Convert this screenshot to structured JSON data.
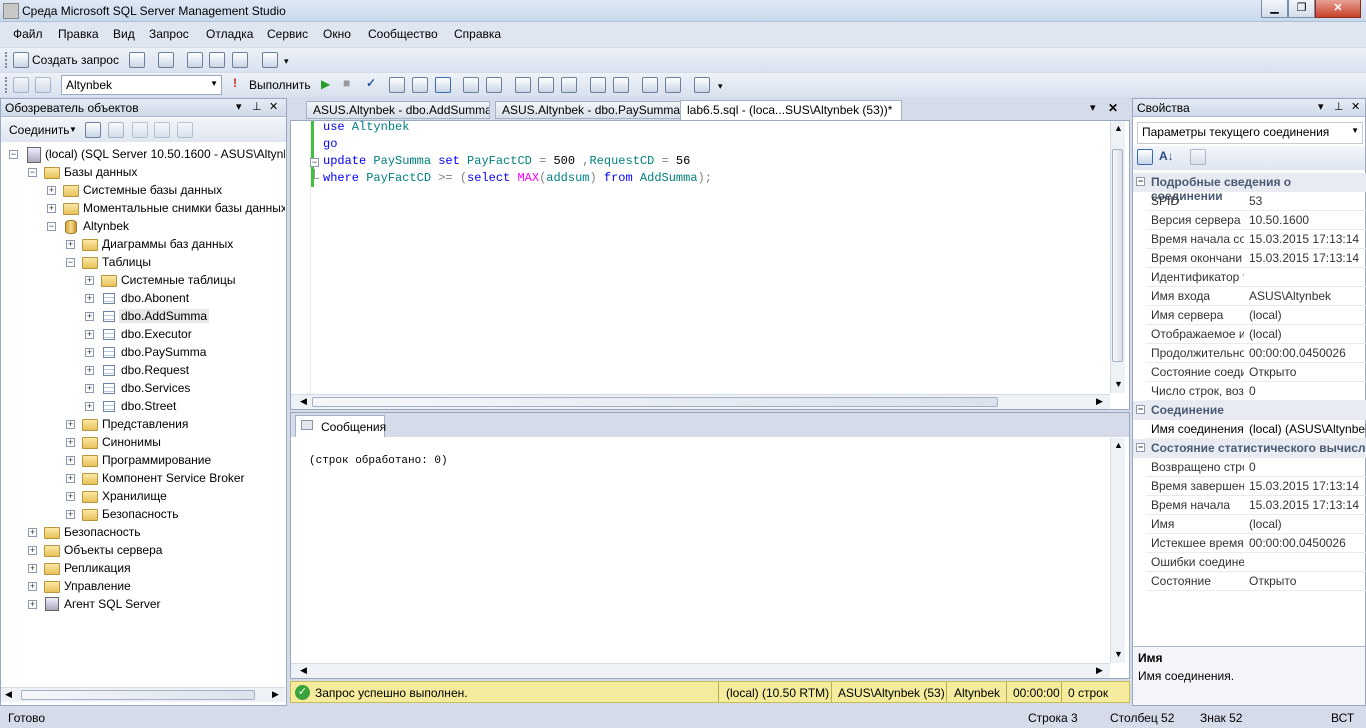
{
  "window": {
    "title": "Среда Microsoft SQL Server Management Studio"
  },
  "menu": [
    "Файл",
    "Правка",
    "Вид",
    "Запрос",
    "Отладка",
    "Сервис",
    "Окно",
    "Сообщество",
    "Справка"
  ],
  "toolbar1": {
    "new_query": "Создать запрос"
  },
  "toolbar2": {
    "database": "Altynbek",
    "execute": "Выполнить"
  },
  "object_explorer": {
    "title": "Обозреватель объектов",
    "connect": "Соединить",
    "root": "(local) (SQL Server 10.50.1600 - ASUS\\Altynbek)",
    "nodes": [
      "Базы данных",
      "Системные базы данных",
      "Моментальные снимки базы данных",
      "Altynbek",
      "Диаграммы баз данных",
      "Таблицы",
      "Системные таблицы",
      "dbo.Abonent",
      "dbo.AddSumma",
      "dbo.Executor",
      "dbo.PaySumma",
      "dbo.Request",
      "dbo.Services",
      "dbo.Street",
      "Представления",
      "Синонимы",
      "Программирование",
      "Компонент Service Broker",
      "Хранилище",
      "Безопасность",
      "Безопасность",
      "Объекты сервера",
      "Репликация",
      "Управление",
      "Агент SQL Server"
    ]
  },
  "tabs": [
    "ASUS.Altynbek - dbo.AddSumma",
    "ASUS.Altynbek - dbo.PaySumma",
    "lab6.5.sql - (loca...SUS\\Altynbek (53))*"
  ],
  "editor": {
    "l1a": "use",
    "l1b": " Altynbek",
    "l2": "go",
    "l3a": "update",
    "l3b": " PaySumma ",
    "l3c": "set",
    "l3d": " PayFactCD ",
    "l3e": "=",
    "l3f": " 500 ",
    "l3g": ",",
    "l3h": "RequestCD ",
    "l3i": "=",
    "l3j": " 56",
    "l4a": "where",
    "l4b": " PayFactCD ",
    "l4c": ">=",
    "l4d": " ",
    "l4e": "(",
    "l4f": "select",
    "l4g": " ",
    "l4h": "MAX",
    "l4i": "(",
    "l4j": "addsum",
    "l4k": ")",
    "l4l": " ",
    "l4m": "from",
    "l4n": " AddSumma",
    "l4o": ");"
  },
  "results": {
    "tab": "Сообщения",
    "message": "(строк обработано: 0)"
  },
  "query_status": {
    "text": "Запрос успешно выполнен.",
    "server": "(local) (10.50 RTM)",
    "user": "ASUS\\Altynbek (53)",
    "db": "Altynbek",
    "time": "00:00:00",
    "rows": "0 строк"
  },
  "properties": {
    "title": "Свойства",
    "selector": "Параметры текущего соединения",
    "cat1": "Подробные сведения о соединении",
    "rows1": [
      [
        "SPID",
        "53"
      ],
      [
        "Версия сервера",
        "10.50.1600"
      ],
      [
        "Время начала со",
        "15.03.2015 17:13:14"
      ],
      [
        "Время окончани",
        "15.03.2015 17:13:14"
      ],
      [
        "Идентификатор т",
        ""
      ],
      [
        "Имя входа",
        "ASUS\\Altynbek"
      ],
      [
        "Имя сервера",
        "(local)"
      ],
      [
        "Отображаемое и",
        "(local)"
      ],
      [
        "Продолжительно",
        "00:00:00.0450026"
      ],
      [
        "Состояние соеди",
        "Открыто"
      ],
      [
        "Число строк, воз",
        "0"
      ]
    ],
    "cat2": "Соединение",
    "rows2": [
      [
        "Имя соединения",
        "(local) (ASUS\\Altynbek)"
      ]
    ],
    "cat3": "Состояние статистического вычисле",
    "rows3": [
      [
        "Возвращено стро",
        "0"
      ],
      [
        "Время завершен",
        "15.03.2015 17:13:14"
      ],
      [
        "Время начала",
        "15.03.2015 17:13:14"
      ],
      [
        "Имя",
        "(local)"
      ],
      [
        "Истекшее время",
        "00:00:00.0450026"
      ],
      [
        "Ошибки соедине",
        ""
      ],
      [
        "Состояние",
        "Открыто"
      ]
    ],
    "desc_title": "Имя",
    "desc_text": "Имя соединения."
  },
  "status": {
    "ready": "Готово",
    "line": "Строка 3",
    "col": "Столбец 52",
    "char": "Знак 52",
    "ins": "ВСТ"
  }
}
